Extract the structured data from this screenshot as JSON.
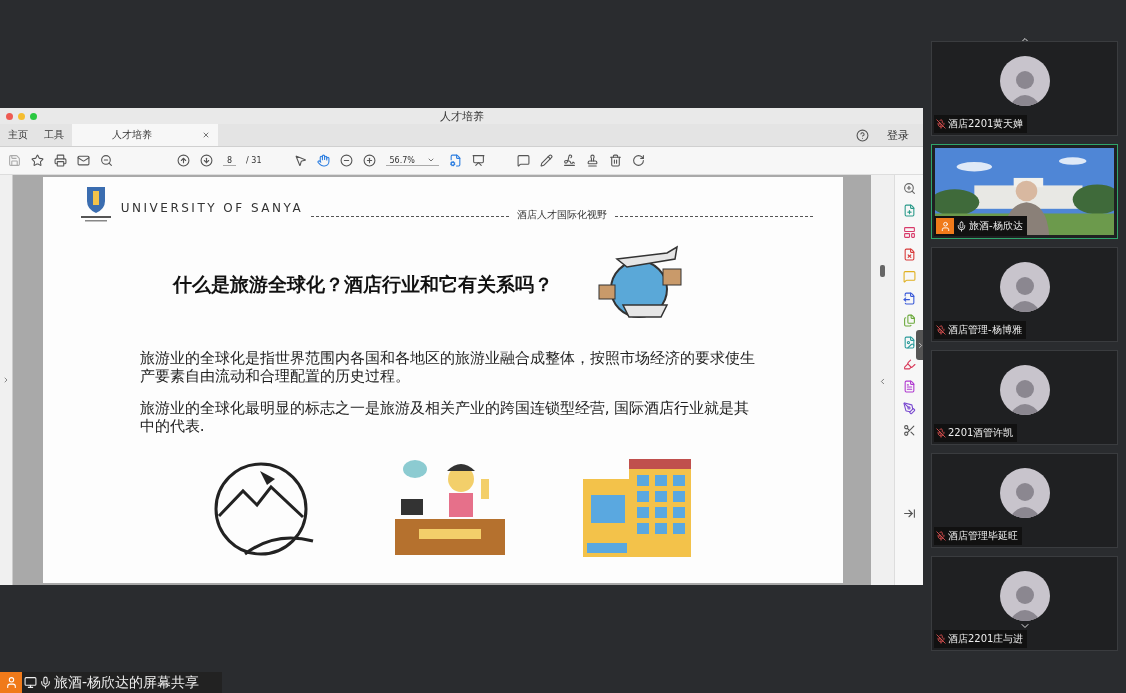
{
  "window": {
    "title": "人才培养"
  },
  "tabs": [
    {
      "label": "主页",
      "selected": false
    },
    {
      "label": "工具",
      "selected": false
    },
    {
      "label": "人才培养",
      "selected": true
    }
  ],
  "login": "登录",
  "toolbar": {
    "page": "8",
    "page_count": "/ 31",
    "zoom": "56.7%"
  },
  "slide": {
    "university": "UNIVERSITY OF SANYA",
    "section": "酒店人才国际化视野",
    "title": "什么是旅游全球化？酒店行业和它有关系吗？",
    "paragraphs": [
      "旅游业的全球化是指世界范围内各国和各地区的旅游业融合成整体，按照市场经济的要求使生产要素自由流动和合理配置的历史过程。",
      "旅游业的全球化最明显的标志之一是旅游及相关产业的跨国连锁型经营, 国际酒店行业就是其中的代表."
    ]
  },
  "participants": [
    {
      "name": "酒店2201黄天婵",
      "kind": "avatar",
      "speaking": false,
      "muted": true
    },
    {
      "name": "旅酒-杨欣达",
      "kind": "video",
      "speaking": true,
      "muted": false
    },
    {
      "name": "酒店管理-杨博雅",
      "kind": "avatar",
      "speaking": false,
      "muted": true
    },
    {
      "name": "2201酒管许凯",
      "kind": "avatar",
      "speaking": false,
      "muted": true
    },
    {
      "name": "酒店管理毕延旺",
      "kind": "avatar",
      "speaking": false,
      "muted": true
    },
    {
      "name": "酒店2201庄与进",
      "kind": "avatar",
      "speaking": false,
      "muted": true
    }
  ],
  "share_label": "旅酒-杨欣达的屏幕共享"
}
